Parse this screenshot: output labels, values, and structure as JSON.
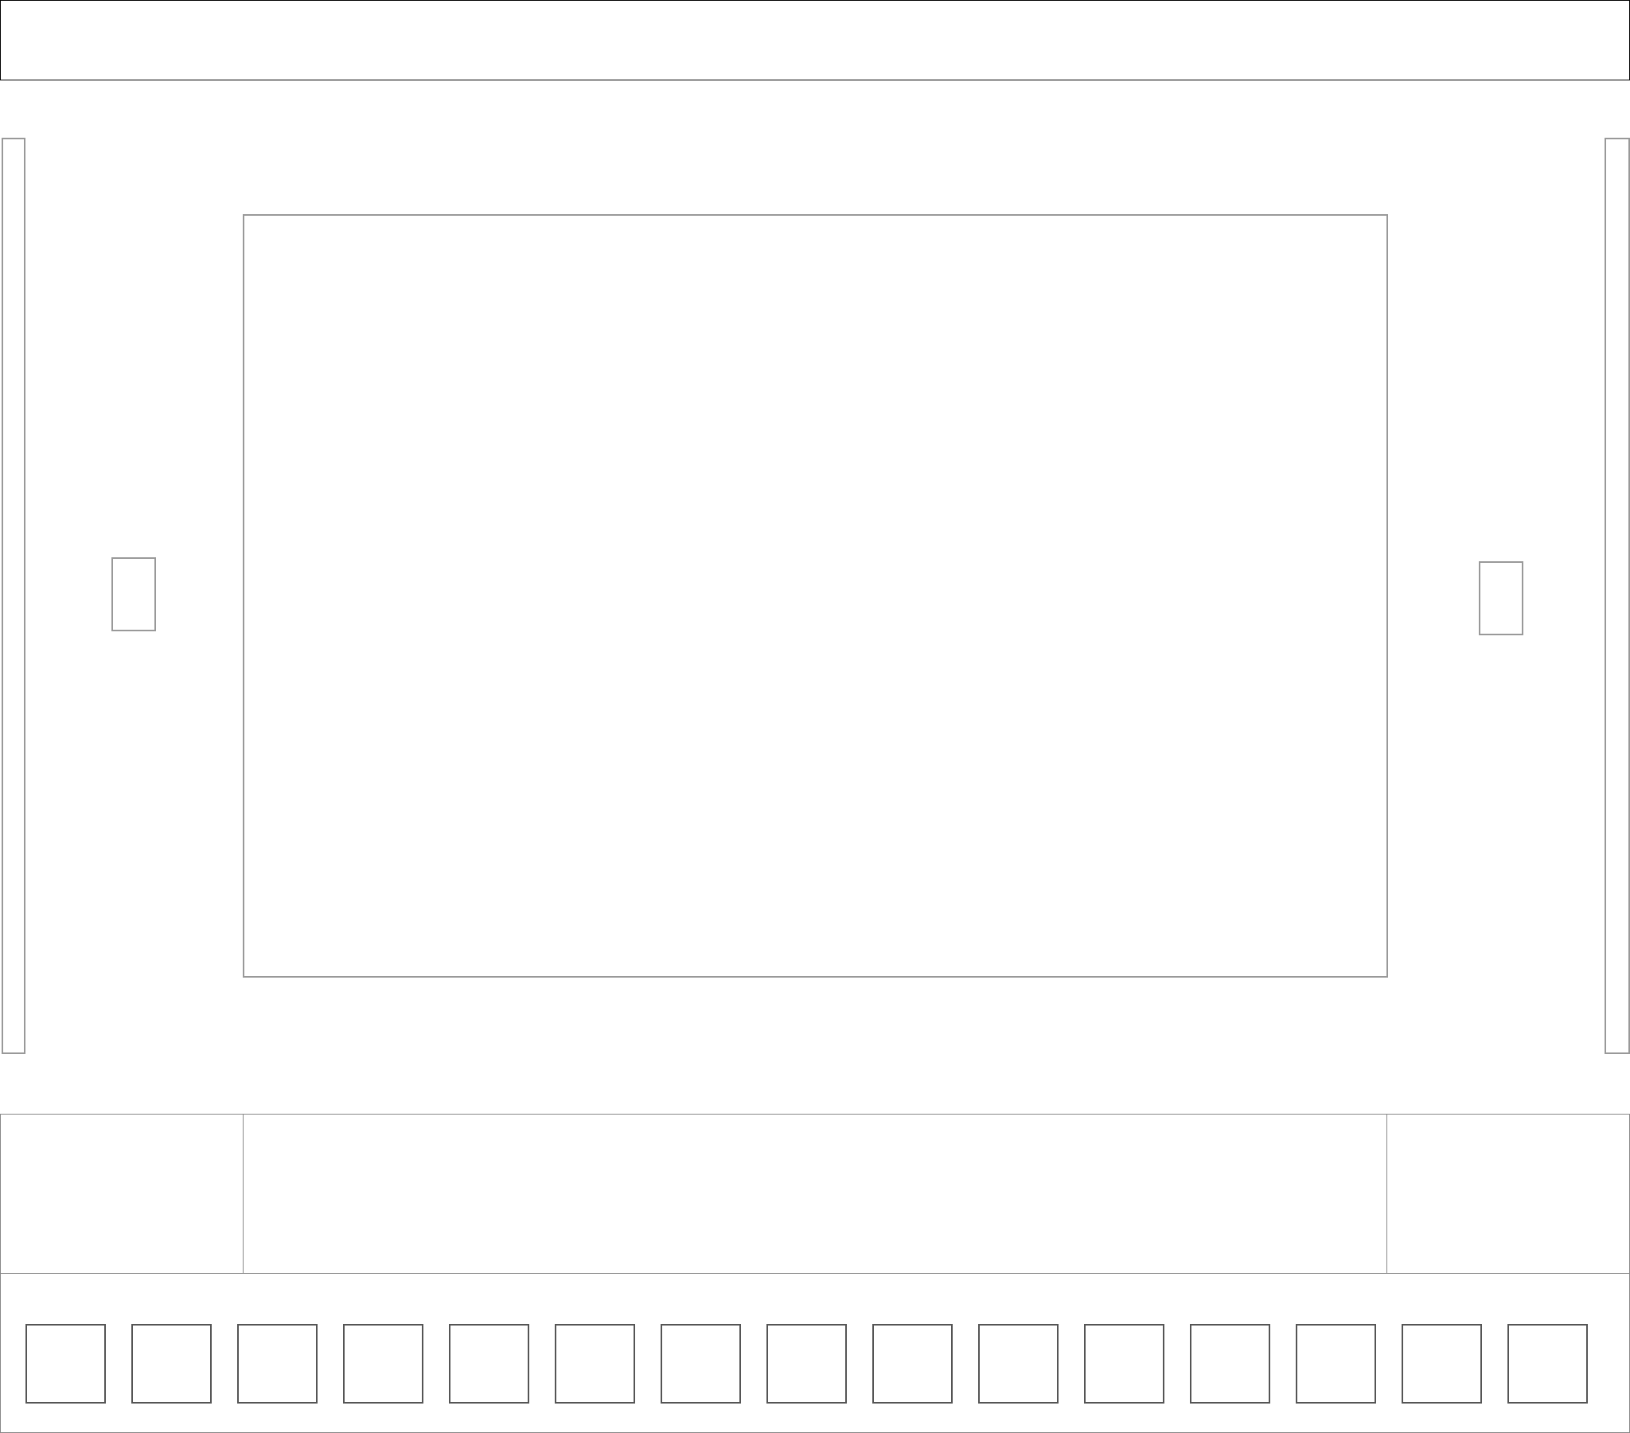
{
  "thumbnails": [
    {
      "id": 1
    },
    {
      "id": 2
    },
    {
      "id": 3
    },
    {
      "id": 4
    },
    {
      "id": 5
    },
    {
      "id": 6
    },
    {
      "id": 7
    },
    {
      "id": 8
    },
    {
      "id": 9
    },
    {
      "id": 10
    },
    {
      "id": 11
    },
    {
      "id": 12
    },
    {
      "id": 13
    },
    {
      "id": 14
    },
    {
      "id": 15
    }
  ]
}
